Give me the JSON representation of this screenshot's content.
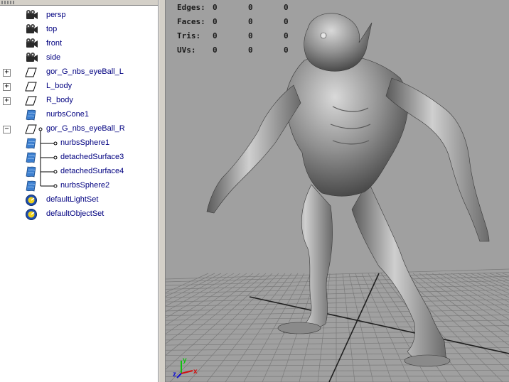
{
  "outliner": {
    "items": [
      {
        "label": "persp",
        "icon": "camera-icon"
      },
      {
        "label": "top",
        "icon": "camera-icon"
      },
      {
        "label": "front",
        "icon": "camera-icon"
      },
      {
        "label": "side",
        "icon": "camera-icon"
      },
      {
        "label": "gor_G_nbs_eyeBall_L",
        "icon": "group-icon",
        "expander": "+"
      },
      {
        "label": "L_body",
        "icon": "group-icon",
        "expander": "+"
      },
      {
        "label": "R_body",
        "icon": "group-icon",
        "expander": "+"
      },
      {
        "label": "nurbsCone1",
        "icon": "nurbs-surface-icon"
      },
      {
        "label": "gor_G_nbs_eyeBall_R",
        "icon": "group-icon",
        "expander": "−"
      },
      {
        "label": "nurbsSphere1",
        "icon": "nurbs-surface-icon",
        "child": true
      },
      {
        "label": "detachedSurface3",
        "icon": "nurbs-surface-icon",
        "child": true
      },
      {
        "label": "detachedSurface4",
        "icon": "nurbs-surface-icon",
        "child": true
      },
      {
        "label": "nurbsSphere2",
        "icon": "nurbs-surface-icon",
        "child": true
      },
      {
        "label": "defaultLightSet",
        "icon": "set-icon"
      },
      {
        "label": "defaultObjectSet",
        "icon": "set-icon"
      }
    ]
  },
  "hud": {
    "rows": [
      {
        "label": "Edges:",
        "v1": "0",
        "v2": "0",
        "v3": "0"
      },
      {
        "label": "Faces:",
        "v1": "0",
        "v2": "0",
        "v3": "0"
      },
      {
        "label": "Tris:",
        "v1": "0",
        "v2": "0",
        "v3": "0"
      },
      {
        "label": "UVs:",
        "v1": "0",
        "v2": "0",
        "v3": "0"
      }
    ]
  },
  "axis": {
    "x": "x",
    "y": "y",
    "z": "z"
  },
  "colors": {
    "outliner_text": "#000080",
    "viewport_bg": "#a0a0a0",
    "grid_line": "#7a7a7a",
    "axis_x": "#d01010",
    "axis_y": "#10c010",
    "axis_z": "#1010d0"
  }
}
